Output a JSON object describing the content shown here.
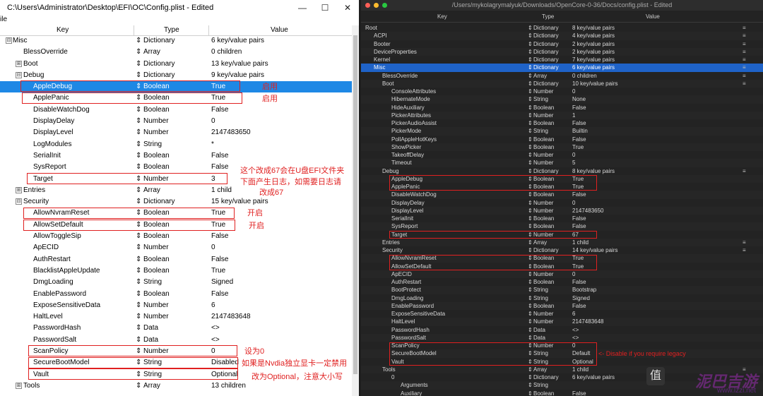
{
  "left": {
    "title": "C:\\Users\\Administrator\\Desktop\\EFI\\OC\\Config.plist - Edited",
    "menu": "ile",
    "window_btn_min": "—",
    "window_btn_max": "☐",
    "window_btn_close": "✕",
    "headers": {
      "key": "Key",
      "type": "Type",
      "value": "Value"
    },
    "rows": [
      {
        "k": "Misc",
        "t": "Dictionary",
        "v": "6 key/value pairs",
        "lvl": 0,
        "exp": "⊟"
      },
      {
        "k": "BlessOverride",
        "t": "Array",
        "v": "0 children",
        "lvl": 1
      },
      {
        "k": "Boot",
        "t": "Dictionary",
        "v": "13 key/value pairs",
        "lvl": 1,
        "exp": "⊞"
      },
      {
        "k": "Debug",
        "t": "Dictionary",
        "v": "9 key/value pairs",
        "lvl": 1,
        "exp": "⊟"
      },
      {
        "k": "AppleDebug",
        "t": "Boolean",
        "v": "True",
        "lvl": 2,
        "sel": true
      },
      {
        "k": "ApplePanic",
        "t": "Boolean",
        "v": "True",
        "lvl": 2
      },
      {
        "k": "DisableWatchDog",
        "t": "Boolean",
        "v": "False",
        "lvl": 2
      },
      {
        "k": "DisplayDelay",
        "t": "Number",
        "v": "0",
        "lvl": 2
      },
      {
        "k": "DisplayLevel",
        "t": "Number",
        "v": "2147483650",
        "lvl": 2
      },
      {
        "k": "LogModules",
        "t": "String",
        "v": "*",
        "lvl": 2
      },
      {
        "k": "SerialInit",
        "t": "Boolean",
        "v": "False",
        "lvl": 2
      },
      {
        "k": "SysReport",
        "t": "Boolean",
        "v": "False",
        "lvl": 2
      },
      {
        "k": "Target",
        "t": "Number",
        "v": "3",
        "lvl": 2
      },
      {
        "k": "Entries",
        "t": "Array",
        "v": "1 child",
        "lvl": 1,
        "exp": "⊞"
      },
      {
        "k": "Security",
        "t": "Dictionary",
        "v": "15 key/value pairs",
        "lvl": 1,
        "exp": "⊟"
      },
      {
        "k": "AllowNvramReset",
        "t": "Boolean",
        "v": "True",
        "lvl": 2
      },
      {
        "k": "AllowSetDefault",
        "t": "Boolean",
        "v": "True",
        "lvl": 2
      },
      {
        "k": "AllowToggleSip",
        "t": "Boolean",
        "v": "False",
        "lvl": 2
      },
      {
        "k": "ApECID",
        "t": "Number",
        "v": "0",
        "lvl": 2
      },
      {
        "k": "AuthRestart",
        "t": "Boolean",
        "v": "False",
        "lvl": 2
      },
      {
        "k": "BlacklistAppleUpdate",
        "t": "Boolean",
        "v": "True",
        "lvl": 2
      },
      {
        "k": "DmgLoading",
        "t": "String",
        "v": "Signed",
        "lvl": 2
      },
      {
        "k": "EnablePassword",
        "t": "Boolean",
        "v": "False",
        "lvl": 2
      },
      {
        "k": "ExposeSensitiveData",
        "t": "Number",
        "v": "6",
        "lvl": 2
      },
      {
        "k": "HaltLevel",
        "t": "Number",
        "v": "2147483648",
        "lvl": 2
      },
      {
        "k": "PasswordHash",
        "t": "Data",
        "v": "<>",
        "lvl": 2
      },
      {
        "k": "PasswordSalt",
        "t": "Data",
        "v": "<>",
        "lvl": 2
      },
      {
        "k": "ScanPolicy",
        "t": "Number",
        "v": "0",
        "lvl": 2
      },
      {
        "k": "SecureBootModel",
        "t": "String",
        "v": "Disabled",
        "lvl": 2
      },
      {
        "k": "Vault",
        "t": "String",
        "v": "Optional",
        "lvl": 2
      },
      {
        "k": "Tools",
        "t": "Array",
        "v": "13 children",
        "lvl": 1,
        "exp": "⊞"
      }
    ],
    "annotations": {
      "a1": "启用",
      "a2": "启用",
      "a3": "这个改成67会在U盘EFI文件夹",
      "a4": "下面产生日志，如需要日志请",
      "a5": "改成67",
      "a6": "开启",
      "a7": "开启",
      "a8": "设为0",
      "a9": "如果是Nvdia独立显卡一定禁用",
      "a10": "改为Optional，注意大小写"
    }
  },
  "right": {
    "title": "/Users/mykolagrymalyuk/Downloads/OpenCore-0-36/Docs/config.plist - Edited",
    "dot_colors": [
      "#ff5f57",
      "#febc2e",
      "#28c840"
    ],
    "headers": {
      "key": "Key",
      "type": "Type",
      "value": "Value"
    },
    "rows": [
      {
        "k": "Root",
        "t": "Dictionary",
        "v": "8 key/value pairs",
        "lvl": 0
      },
      {
        "k": "ACPI",
        "t": "Dictionary",
        "v": "4 key/value pairs",
        "lvl": 1
      },
      {
        "k": "Booter",
        "t": "Dictionary",
        "v": "2 key/value pairs",
        "lvl": 1
      },
      {
        "k": "DeviceProperties",
        "t": "Dictionary",
        "v": "2 key/value pairs",
        "lvl": 1
      },
      {
        "k": "Kernel",
        "t": "Dictionary",
        "v": "7 key/value pairs",
        "lvl": 1
      },
      {
        "k": "Misc",
        "t": "Dictionary",
        "v": "6 key/value pairs",
        "lvl": 1,
        "sel": true
      },
      {
        "k": "BlessOverride",
        "t": "Array",
        "v": "0 children",
        "lvl": 2
      },
      {
        "k": "Boot",
        "t": "Dictionary",
        "v": "10 key/value pairs",
        "lvl": 2
      },
      {
        "k": "ConsoleAttributes",
        "t": "Number",
        "v": "0",
        "lvl": 3
      },
      {
        "k": "HibernateMode",
        "t": "String",
        "v": "None",
        "lvl": 3
      },
      {
        "k": "HideAuxiliary",
        "t": "Boolean",
        "v": "False",
        "lvl": 3
      },
      {
        "k": "PickerAttributes",
        "t": "Number",
        "v": "1",
        "lvl": 3
      },
      {
        "k": "PickerAudioAssist",
        "t": "Boolean",
        "v": "False",
        "lvl": 3
      },
      {
        "k": "PickerMode",
        "t": "String",
        "v": "Builtin",
        "lvl": 3
      },
      {
        "k": "PollAppleHotKeys",
        "t": "Boolean",
        "v": "False",
        "lvl": 3
      },
      {
        "k": "ShowPicker",
        "t": "Boolean",
        "v": "True",
        "lvl": 3
      },
      {
        "k": "TakeoffDelay",
        "t": "Number",
        "v": "0",
        "lvl": 3
      },
      {
        "k": "Timeout",
        "t": "Number",
        "v": "5",
        "lvl": 3
      },
      {
        "k": "Debug",
        "t": "Dictionary",
        "v": "8 key/value pairs",
        "lvl": 2
      },
      {
        "k": "AppleDebug",
        "t": "Boolean",
        "v": "True",
        "lvl": 3
      },
      {
        "k": "ApplePanic",
        "t": "Boolean",
        "v": "True",
        "lvl": 3
      },
      {
        "k": "DisableWatchDog",
        "t": "Boolean",
        "v": "False",
        "lvl": 3
      },
      {
        "k": "DisplayDelay",
        "t": "Number",
        "v": "0",
        "lvl": 3
      },
      {
        "k": "DisplayLevel",
        "t": "Number",
        "v": "2147483650",
        "lvl": 3
      },
      {
        "k": "SerialInit",
        "t": "Boolean",
        "v": "False",
        "lvl": 3
      },
      {
        "k": "SysReport",
        "t": "Boolean",
        "v": "False",
        "lvl": 3
      },
      {
        "k": "Target",
        "t": "Number",
        "v": "67",
        "lvl": 3
      },
      {
        "k": "Entries",
        "t": "Array",
        "v": "1 child",
        "lvl": 2
      },
      {
        "k": "Security",
        "t": "Dictionary",
        "v": "14 key/value pairs",
        "lvl": 2
      },
      {
        "k": "AllowNvramReset",
        "t": "Boolean",
        "v": "True",
        "lvl": 3
      },
      {
        "k": "AllowSetDefault",
        "t": "Boolean",
        "v": "True",
        "lvl": 3
      },
      {
        "k": "ApECID",
        "t": "Number",
        "v": "0",
        "lvl": 3
      },
      {
        "k": "AuthRestart",
        "t": "Boolean",
        "v": "False",
        "lvl": 3
      },
      {
        "k": "BootProtect",
        "t": "String",
        "v": "Bootstrap",
        "lvl": 3
      },
      {
        "k": "DmgLoading",
        "t": "String",
        "v": "Signed",
        "lvl": 3
      },
      {
        "k": "EnablePassword",
        "t": "Boolean",
        "v": "False",
        "lvl": 3
      },
      {
        "k": "ExposeSensitiveData",
        "t": "Number",
        "v": "6",
        "lvl": 3
      },
      {
        "k": "HaltLevel",
        "t": "Number",
        "v": "2147483648",
        "lvl": 3
      },
      {
        "k": "PasswordHash",
        "t": "Data",
        "v": "<>",
        "lvl": 3
      },
      {
        "k": "PasswordSalt",
        "t": "Data",
        "v": "<>",
        "lvl": 3
      },
      {
        "k": "ScanPolicy",
        "t": "Number",
        "v": "0",
        "lvl": 3
      },
      {
        "k": "SecureBootModel",
        "t": "String",
        "v": "Default",
        "lvl": 3
      },
      {
        "k": "Vault",
        "t": "String",
        "v": "Optional",
        "lvl": 3
      },
      {
        "k": "Tools",
        "t": "Array",
        "v": "1 child",
        "lvl": 2
      },
      {
        "k": "0",
        "t": "Dictionary",
        "v": "6 key/value pairs",
        "lvl": 3
      },
      {
        "k": "Arguments",
        "t": "String",
        "v": "",
        "lvl": 4
      },
      {
        "k": "Auxiliary",
        "t": "Boolean",
        "v": "False",
        "lvl": 4
      }
    ],
    "annotation": "<- Disable if you require legacy",
    "watermark": "泥巴吉游",
    "watermark_sub": "www.lzzi.net",
    "watermark_badge": "值"
  }
}
